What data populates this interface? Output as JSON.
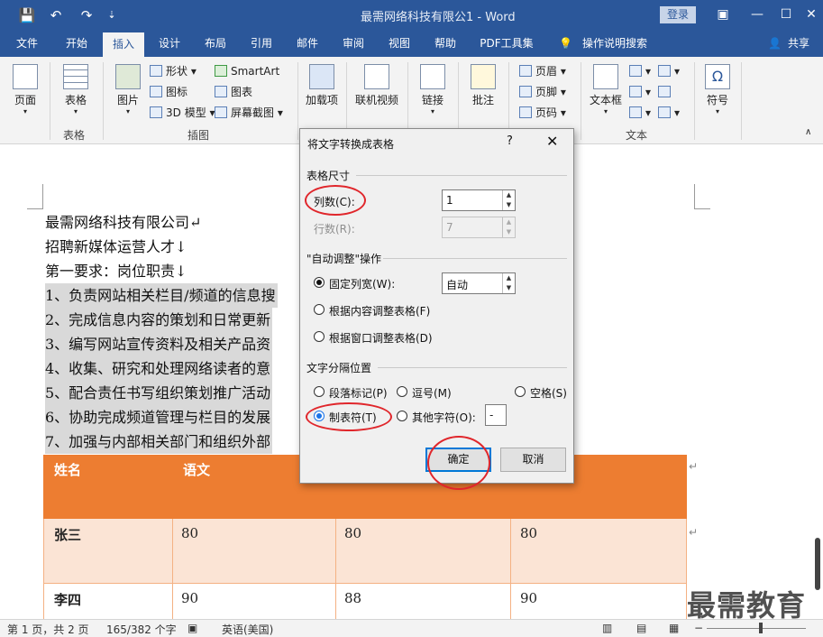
{
  "titlebar": {
    "doc_title": "最需网络科技有限公1 - Word",
    "login": "登录",
    "qa_save": "💾",
    "qa_undo": "↶",
    "qa_redo": "↷",
    "qa_more": "⇣",
    "win_restore": "▣",
    "win_min": "—",
    "win_max": "☐",
    "win_close": "✕"
  },
  "tabs": [
    "文件",
    "开始",
    "插入",
    "设计",
    "布局",
    "引用",
    "邮件",
    "审阅",
    "视图",
    "帮助",
    "PDF工具集",
    "操作说明搜索",
    "共享"
  ],
  "ribbon": {
    "page": "页面",
    "table": "表格",
    "table_group": "表格",
    "picture": "图片",
    "shapes": "形状",
    "icons": "图标",
    "model3d": "3D 模型",
    "smartart": "SmartArt",
    "chart": "图表",
    "screenshot": "屏幕截图",
    "illustrations_group": "插图",
    "addins": "加载项",
    "online_video": "联机视频",
    "link": "链接",
    "comment": "批注",
    "header": "页眉",
    "footer": "页脚",
    "page_number": "页码",
    "textbox": "文本框",
    "text_group": "文本",
    "symbol": "符号"
  },
  "document": {
    "lines": [
      "最需网络科技有限公司↵",
      "招聘新媒体运营人才↓",
      "第一要求：岗位职责↓",
      "1、负责网站相关栏目/频道的信息搜",
      "2、完成信息内容的策划和日常更新",
      "3、编写网站宣传资料及相关产品资",
      "4、收集、研究和处理网络读者的意",
      "5、配合责任书写组织策划推广活动",
      "6、协助完成频道管理与栏目的发展",
      "7、加强与内部相关部门和组织外部"
    ],
    "table": {
      "headers": [
        "姓名",
        "语文",
        "",
        ""
      ],
      "rows": [
        [
          "张三",
          "80",
          "80",
          "80"
        ],
        [
          "李四",
          "90",
          "88",
          "90"
        ]
      ]
    }
  },
  "dialog": {
    "title": "将文字转换成表格",
    "help": "?",
    "close": "✕",
    "section_size": "表格尺寸",
    "cols_label": "列数(C):",
    "cols_value": "1",
    "rows_label": "行数(R):",
    "rows_value": "7",
    "section_autofit": "\"自动调整\"操作",
    "fixed_width": "固定列宽(W):",
    "fixed_width_value": "自动",
    "autofit_content": "根据内容调整表格(F)",
    "autofit_window": "根据窗口调整表格(D)",
    "section_separator": "文字分隔位置",
    "sep_paragraph": "段落标记(P)",
    "sep_comma": "逗号(M)",
    "sep_space": "空格(S)",
    "sep_tab": "制表符(T)",
    "sep_other": "其他字符(O):",
    "sep_other_value": "-",
    "ok": "确定",
    "cancel": "取消"
  },
  "status": {
    "page": "第 1 页，共 2 页",
    "words": "165/382 个字",
    "lang": "英语(美国)"
  },
  "watermark": "最需教育"
}
